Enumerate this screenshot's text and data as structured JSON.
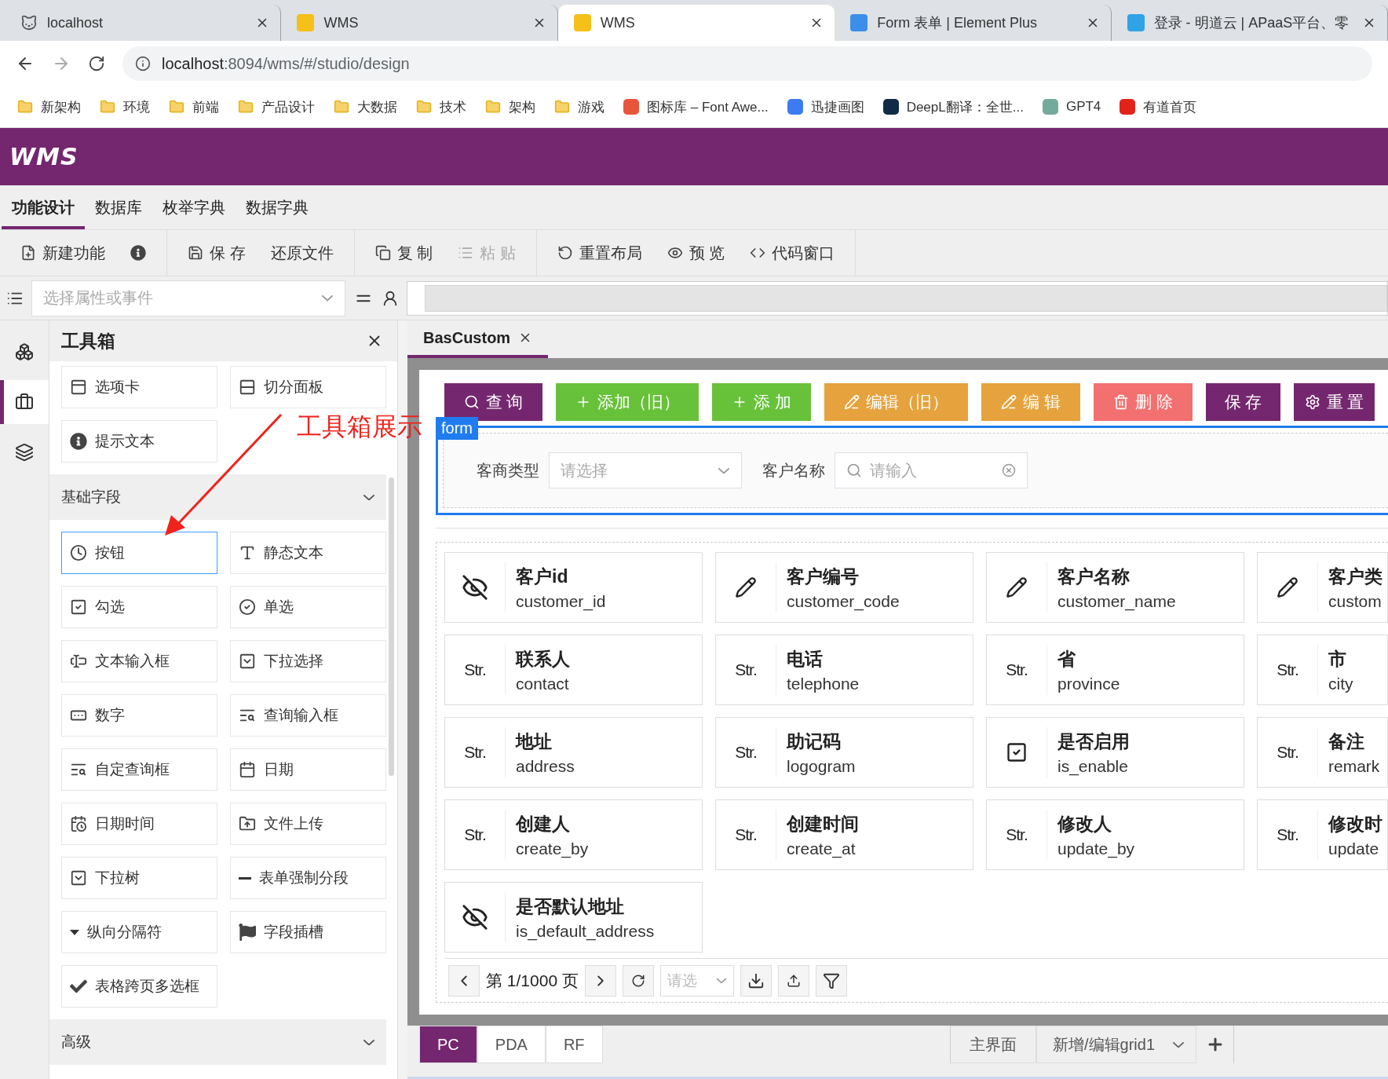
{
  "browser": {
    "tabs": [
      {
        "title": "localhost",
        "selected": false
      },
      {
        "title": "WMS",
        "selected": false
      },
      {
        "title": "WMS",
        "selected": true
      },
      {
        "title": "Form 表单 | Element Plus",
        "selected": false
      },
      {
        "title": "登录 - 明道云 | APaaS平台、零",
        "selected": false
      }
    ],
    "address": {
      "host": "localhost",
      "path": ":8094/wms/#/studio/design"
    },
    "bookmarks": [
      {
        "label": "新架构",
        "kind": "folder"
      },
      {
        "label": "环境",
        "kind": "folder"
      },
      {
        "label": "前端",
        "kind": "folder"
      },
      {
        "label": "产品设计",
        "kind": "folder"
      },
      {
        "label": "大数据",
        "kind": "folder"
      },
      {
        "label": "技术",
        "kind": "folder"
      },
      {
        "label": "架构",
        "kind": "folder"
      },
      {
        "label": "游戏",
        "kind": "folder"
      },
      {
        "label": "图标库 – Font Awe...",
        "kind": "site",
        "color": "#e8553a"
      },
      {
        "label": "迅捷画图",
        "kind": "site",
        "color": "#3d7cf0"
      },
      {
        "label": "DeepL翻译：全世...",
        "kind": "site",
        "color": "#0f2b46"
      },
      {
        "label": "GPT4",
        "kind": "site",
        "color": "#74aa9c"
      },
      {
        "label": "有道首页",
        "kind": "site",
        "color": "#e0231b"
      }
    ]
  },
  "header": {
    "logo": "WMS"
  },
  "nav": [
    {
      "label": "功能设计",
      "selected": true
    },
    {
      "label": "数据库",
      "selected": false
    },
    {
      "label": "枚举字典",
      "selected": false
    },
    {
      "label": "数据字典",
      "selected": false
    }
  ],
  "toolbar": [
    [
      {
        "label": "新建功能",
        "disabled": false
      },
      {
        "disabled": false
      }
    ],
    [
      {
        "label": "保 存",
        "disabled": false
      },
      {
        "label": "还原文件",
        "disabled": false
      }
    ],
    [
      {
        "label": "复 制",
        "disabled": false
      },
      {
        "label": "粘 贴",
        "disabled": true
      }
    ],
    [
      {
        "label": "重置布局",
        "disabled": false
      },
      {
        "label": "预 览",
        "disabled": false
      },
      {
        "label": "代码窗口",
        "disabled": false
      }
    ]
  ],
  "property_bar": {
    "placeholder": "选择属性或事件"
  },
  "rail": [
    {
      "selected": false
    },
    {
      "selected": true
    },
    {
      "selected": false
    }
  ],
  "toolbox": {
    "title": "工具箱",
    "top_items": [
      {
        "label": "选项卡",
        "selected": false
      },
      {
        "label": "切分面板",
        "selected": false
      },
      {
        "label": "提示文本",
        "selected": false
      }
    ],
    "sections": [
      {
        "title": "基础字段",
        "items": [
          {
            "label": "按钮",
            "selected": true
          },
          {
            "label": "静态文本",
            "selected": false
          },
          {
            "label": "勾选",
            "selected": false
          },
          {
            "label": "单选",
            "selected": false
          },
          {
            "label": "文本输入框",
            "selected": false
          },
          {
            "label": "下拉选择",
            "selected": false
          },
          {
            "label": "数字",
            "selected": false
          },
          {
            "label": "查询输入框",
            "selected": false
          },
          {
            "label": "自定查询框",
            "selected": false
          },
          {
            "label": "日期",
            "selected": false
          },
          {
            "label": "日期时间",
            "selected": false
          },
          {
            "label": "文件上传",
            "selected": false
          },
          {
            "label": "下拉树",
            "selected": false
          },
          {
            "label": "表单强制分段",
            "selected": false
          },
          {
            "label": "纵向分隔符",
            "selected": false
          },
          {
            "label": "字段插槽",
            "selected": false
          },
          {
            "label": "表格跨页多选框",
            "selected": false
          }
        ]
      },
      {
        "title": "高级"
      }
    ]
  },
  "annotation": {
    "text": "工具箱展示"
  },
  "editor": {
    "tab": "BasCustom",
    "buttons": [
      {
        "label": "查 询",
        "color": "#74276f"
      },
      {
        "label": "添加（旧）",
        "color": "#67c23a"
      },
      {
        "label": "添 加",
        "color": "#67c23a"
      },
      {
        "label": "编辑（旧）",
        "color": "#e6a23c"
      },
      {
        "label": "编 辑",
        "color": "#e6a23c"
      },
      {
        "label": "删 除",
        "color": "#f37070"
      },
      {
        "label": "保 存",
        "color": "#74276f"
      },
      {
        "label": "重 置",
        "color": "#74276f"
      }
    ],
    "form": {
      "tag": "form",
      "fields": [
        {
          "label": "客商类型",
          "kind": "select",
          "placeholder": "请选择"
        },
        {
          "label": "客户名称",
          "kind": "search",
          "placeholder": "请输入"
        }
      ]
    },
    "cards": [
      {
        "title": "客户id",
        "code": "customer_id",
        "kind": "hidden"
      },
      {
        "title": "客户编号",
        "code": "customer_code",
        "kind": "edit"
      },
      {
        "title": "客户名称",
        "code": "customer_name",
        "kind": "edit"
      },
      {
        "title": "客户类",
        "code": "custom",
        "kind": "edit"
      },
      {
        "title": "联系人",
        "code": "contact",
        "kind": "str",
        "type_label": "Str."
      },
      {
        "title": "电话",
        "code": "telephone",
        "kind": "str",
        "type_label": "Str."
      },
      {
        "title": "省",
        "code": "province",
        "kind": "str",
        "type_label": "Str."
      },
      {
        "title": "市",
        "code": "city",
        "kind": "str",
        "type_label": "Str."
      },
      {
        "title": "地址",
        "code": "address",
        "kind": "str",
        "type_label": "Str."
      },
      {
        "title": "助记码",
        "code": "logogram",
        "kind": "str",
        "type_label": "Str."
      },
      {
        "title": "是否启用",
        "code": "is_enable",
        "kind": "check"
      },
      {
        "title": "备注",
        "code": "remark",
        "kind": "str",
        "type_label": "Str."
      },
      {
        "title": "创建人",
        "code": "create_by",
        "kind": "str",
        "type_label": "Str."
      },
      {
        "title": "创建时间",
        "code": "create_at",
        "kind": "str",
        "type_label": "Str."
      },
      {
        "title": "修改人",
        "code": "update_by",
        "kind": "str",
        "type_label": "Str."
      },
      {
        "title": "修改时",
        "code": "update",
        "kind": "str",
        "type_label": "Str."
      },
      {
        "title": "是否默认地址",
        "code": "is_default_address",
        "kind": "hidden"
      }
    ],
    "pager": {
      "page": "第 1/1000 页",
      "size_placeholder": "请选"
    }
  },
  "bottom": {
    "modes": [
      {
        "label": "PC",
        "selected": true
      },
      {
        "label": "PDA",
        "selected": false
      },
      {
        "label": "RF",
        "selected": false
      }
    ],
    "view": "主界面",
    "select": "新增/编辑grid1"
  }
}
